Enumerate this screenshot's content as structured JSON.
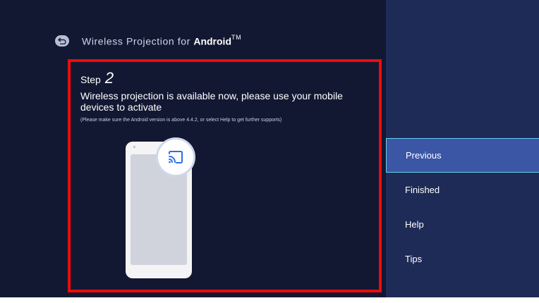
{
  "header": {
    "title_prefix": "Wireless Projection for ",
    "title_brand": "Android",
    "title_superscript": "TM",
    "back_icon": "back-arrow-icon"
  },
  "step": {
    "label": "Step",
    "number": "2",
    "instruction": "Wireless projection is available now, please use your mobile devices to activate",
    "note": "(Please make sure the Android version is above 4.4.2, or select Help to get further supports)",
    "cast_icon": "cast-icon",
    "highlight_color": "#ee0c0c"
  },
  "menu": {
    "items": [
      {
        "label": "Previous",
        "selected": true
      },
      {
        "label": "Finished",
        "selected": false
      },
      {
        "label": "Help",
        "selected": false
      },
      {
        "label": "Tips",
        "selected": false
      }
    ]
  },
  "colors": {
    "background": "#141a33",
    "side_panel": "#1e2b56",
    "selected_item": "#3b56a5",
    "selected_border": "#66d1ee"
  }
}
